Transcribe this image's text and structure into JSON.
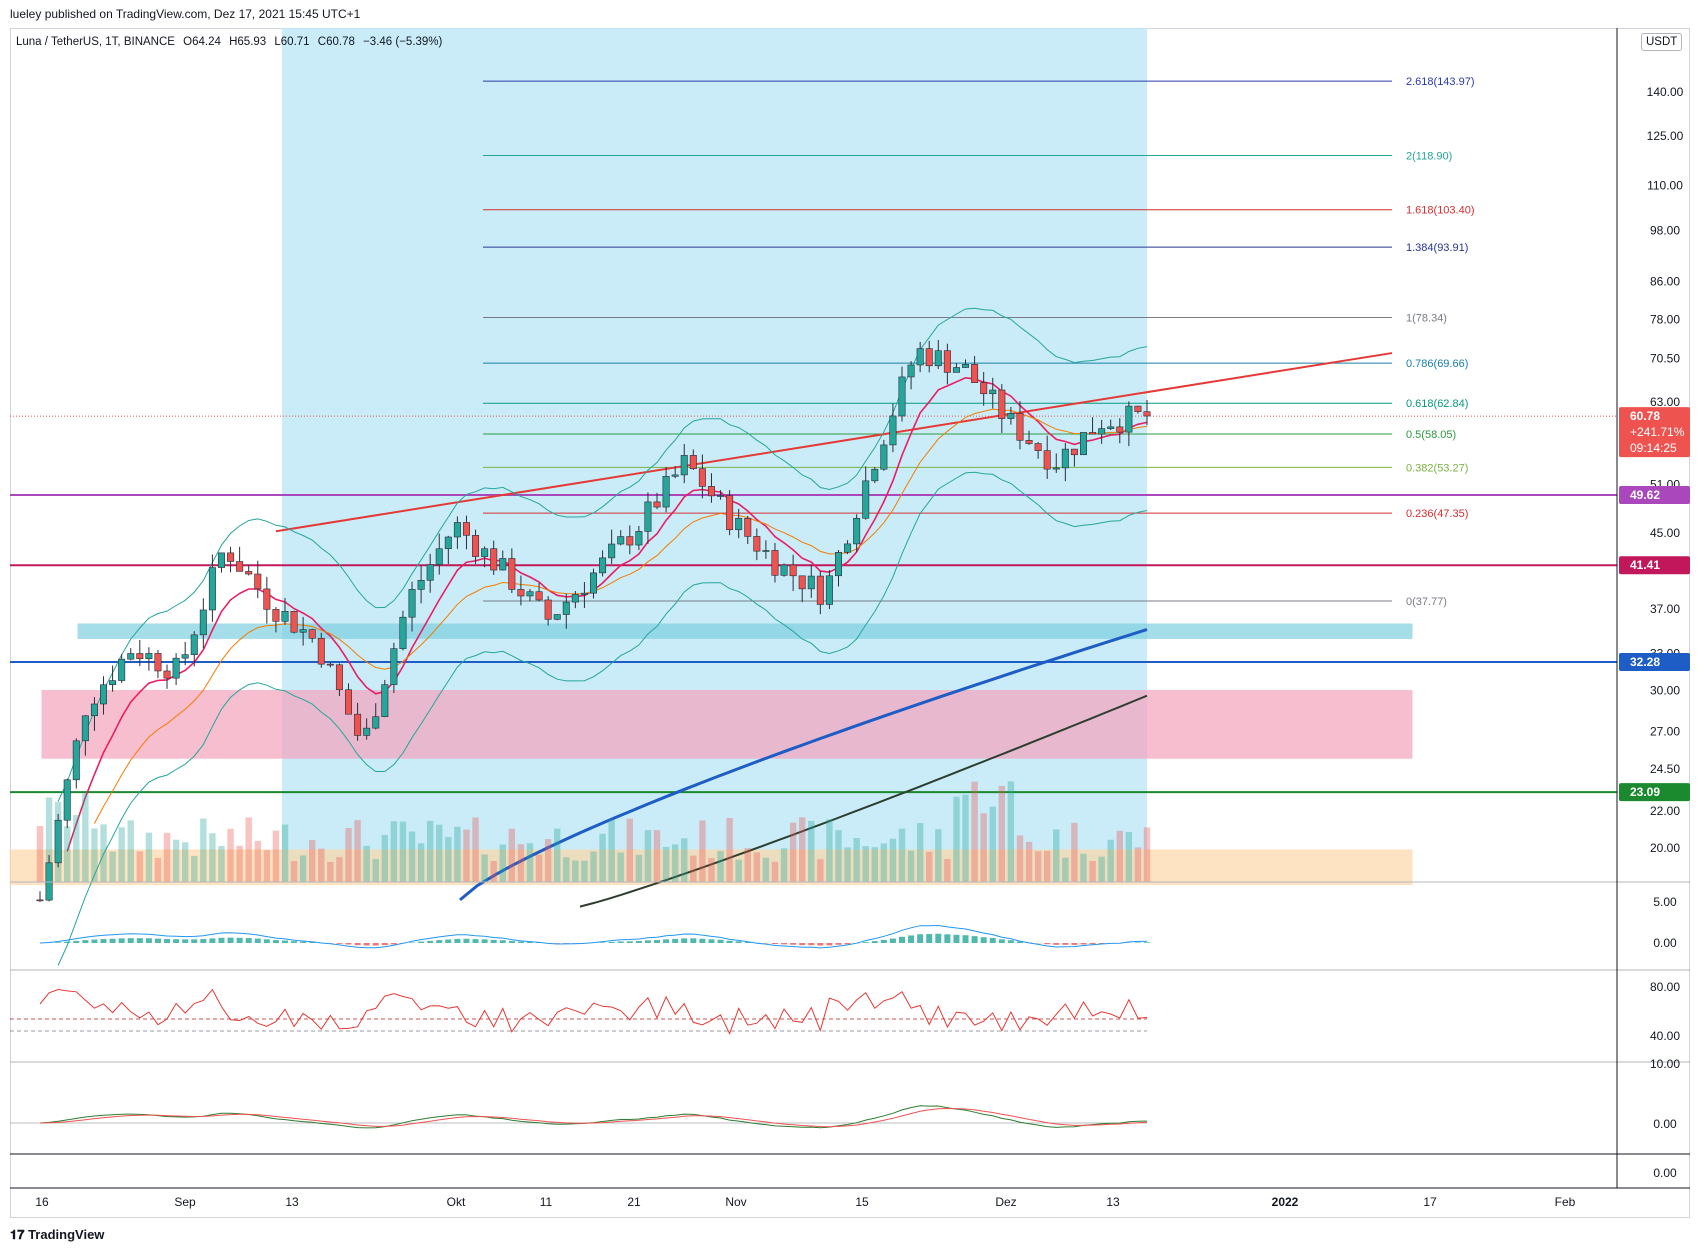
{
  "header": {
    "publisher_text": "lueley published on TradingView.com, Dez 17, 2021 15:45 UTC+1"
  },
  "symbol": {
    "name": "Luna / TetherUS, 1T, BINANCE",
    "open": "O64.24",
    "high": "H65.93",
    "low": "L60.71",
    "close": "C60.78",
    "change": "−3.46 (−5.39%)",
    "currency_button": "USDT"
  },
  "footer": {
    "logo_text": "TradingView"
  },
  "colors": {
    "up": "#26a69a",
    "down": "#ef5350",
    "highlight_region": "#bfe9f7",
    "bb": "#26a69a",
    "ma_blue": "#2962ff",
    "ma_dark": "#2d3e2f"
  },
  "chart_data": [
    {
      "type": "line",
      "panel": "price",
      "y_axis_ticks": [
        "140.00",
        "125.00",
        "110.00",
        "98.00",
        "86.00",
        "78.00",
        "70.50",
        "63.00",
        "51.00",
        "45.00",
        "37.00",
        "33.00",
        "30.00",
        "27.00",
        "24.50",
        "22.00",
        "20.00"
      ],
      "x_axis_ticks": [
        "16",
        "Sep",
        "13",
        "Okt",
        "11",
        "21",
        "Nov",
        "15",
        "Dez",
        "13",
        "2022",
        "17",
        "Feb"
      ],
      "log_scale": true,
      "price_labels": [
        {
          "value": "60.78",
          "sub1": "+241.71%",
          "sub2": "09:14:25",
          "color": "#ef5350"
        },
        {
          "value": "49.62",
          "color": "#ab47bc"
        },
        {
          "value": "41.41",
          "color": "#c2185b"
        },
        {
          "value": "32.28",
          "color": "#1e5cc6"
        },
        {
          "value": "23.09",
          "color": "#1b8a2f"
        }
      ],
      "horizontal_lines": [
        {
          "price": 49.62,
          "color": "#ab47bc"
        },
        {
          "price": 41.41,
          "color": "#c2185b"
        },
        {
          "price": 32.28,
          "color": "#1e5cc6"
        },
        {
          "price": 23.09,
          "color": "#1b8a2f"
        }
      ],
      "fib_levels": [
        {
          "label": "2.618(143.97)",
          "price": 143.97,
          "color": "#2a3aa8"
        },
        {
          "label": "2(118.90)",
          "price": 118.9,
          "color": "#26a69a"
        },
        {
          "label": "1.618(103.40)",
          "price": 103.4,
          "color": "#d32f2f"
        },
        {
          "label": "1.384(93.91)",
          "price": 93.91,
          "color": "#283593"
        },
        {
          "label": "1(78.34)",
          "price": 78.34,
          "color": "#787b86"
        },
        {
          "label": "0.786(69.66)",
          "price": 69.66,
          "color": "#1a7fa8"
        },
        {
          "label": "0.618(62.84)",
          "price": 62.84,
          "color": "#089981"
        },
        {
          "label": "0.5(58.05)",
          "price": 58.05,
          "color": "#2e9b3e"
        },
        {
          "label": "0.382(53.27)",
          "price": 53.27,
          "color": "#7cb342"
        },
        {
          "label": "0.236(47.35)",
          "price": 47.35,
          "color": "#d32f2f"
        },
        {
          "label": "0(37.77)",
          "price": 37.77,
          "color": "#787b86"
        }
      ],
      "zones": [
        {
          "from": 34.3,
          "to": 35.6,
          "color": "#7fd0e0"
        },
        {
          "from": 25.2,
          "to": 30.0,
          "color": "#f5a3bd"
        },
        {
          "from": 18.2,
          "to": 19.9,
          "color": "#fdd8a8"
        }
      ],
      "series": [
        {
          "x": [
            "Aug 16",
            "Aug 23",
            "Aug 30",
            "Sep 6",
            "Sep 10",
            "Sep 13",
            "Sep 20",
            "Sep 24",
            "Sep 27",
            "Okt 4",
            "Okt 11",
            "Okt 18",
            "Okt 25",
            "Nov 1",
            "Nov 8",
            "Nov 15",
            "Nov 22",
            "Nov 26",
            "Dez 1",
            "Dez 4",
            "Dez 8",
            "Dez 11",
            "Dez 13",
            "Dez 15",
            "Dez 17"
          ],
          "y": [
            17.5,
            29.0,
            33.5,
            31.5,
            43.5,
            37.5,
            34.0,
            26.0,
            38.0,
            46.0,
            41.0,
            36.0,
            40.5,
            46.0,
            54.0,
            46.5,
            41.5,
            38.5,
            53.0,
            72.0,
            69.0,
            60.0,
            54.0,
            60.0,
            60.78
          ]
        }
      ]
    },
    {
      "type": "bar",
      "panel": "macd",
      "y_axis_ticks": [
        "5.00",
        "0.00"
      ]
    },
    {
      "type": "line",
      "panel": "rsi",
      "y_axis_ticks": [
        "80.00",
        "40.00"
      ]
    },
    {
      "type": "line",
      "panel": "oscillator",
      "y_axis_ticks": [
        "10.00",
        "0.00",
        "0.00"
      ]
    }
  ]
}
